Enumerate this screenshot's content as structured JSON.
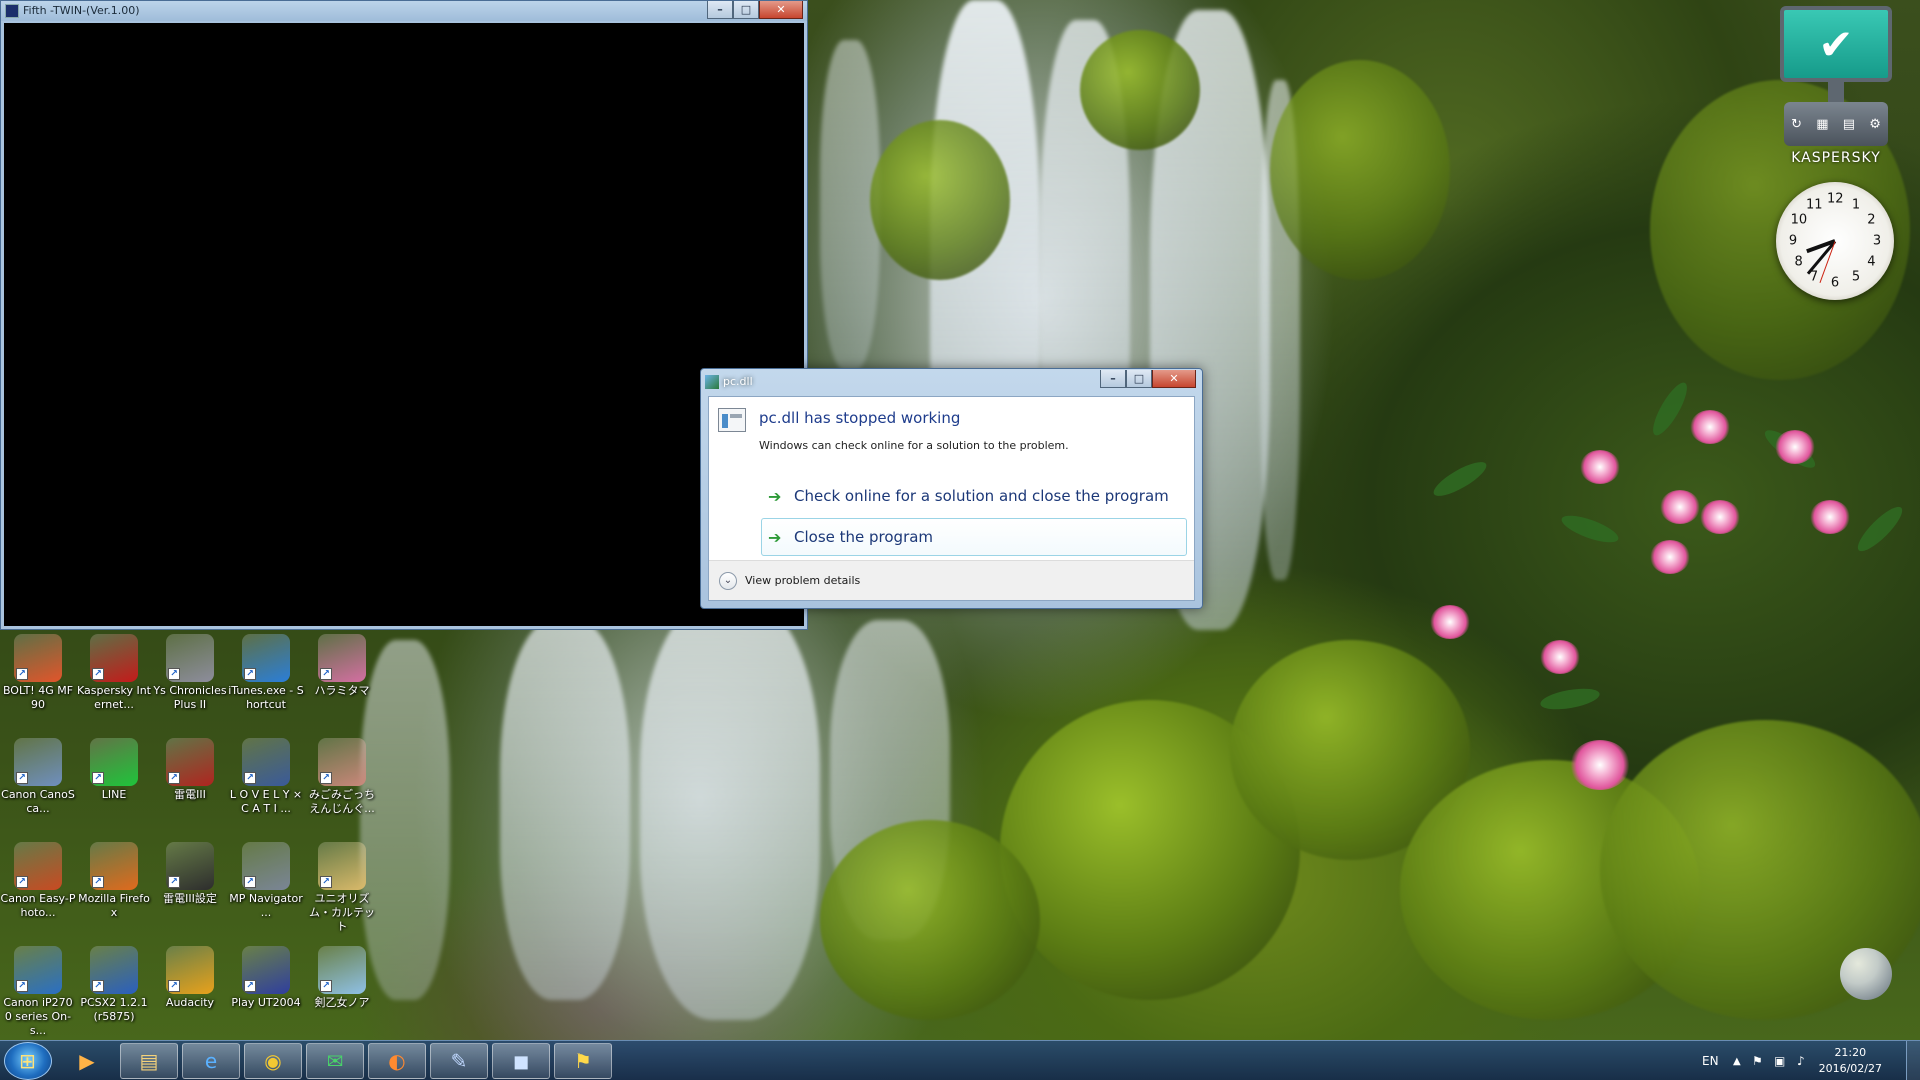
{
  "twin_window": {
    "title": "Fifth -TWIN-(Ver.1.00)"
  },
  "dialog": {
    "title": "pc.dll",
    "heading": "pc.dll has stopped working",
    "description": "Windows can check online for a solution to the problem.",
    "option_check": "Check online for a solution and close the program",
    "option_close": "Close the program",
    "details": "View problem details"
  },
  "desktop_icons": [
    {
      "label": "BOLT! 4G MF90",
      "icon": "bolt-icon",
      "color": "#e2552b"
    },
    {
      "label": "Kaspersky Internet...",
      "icon": "kaspersky-icon",
      "color": "#c41a1a"
    },
    {
      "label": "Ys Chronicles Plus II",
      "icon": "ys-icon",
      "color": "#8d8d9c"
    },
    {
      "label": "iTunes.exe - Shortcut",
      "icon": "itunes-icon",
      "color": "#2b7ed8"
    },
    {
      "label": "ハラミタマ",
      "icon": "anime-icon",
      "color": "#d46fa2"
    },
    {
      "label": "Canon CanoSca...",
      "icon": "canon-icon",
      "color": "#6f8fbf"
    },
    {
      "label": "LINE",
      "icon": "line-icon",
      "color": "#1fc43b"
    },
    {
      "label": "雷電III",
      "icon": "raiden-icon",
      "color": "#b0241f"
    },
    {
      "label": "L O V E L Y × C A T I ...",
      "icon": "lovely-icon",
      "color": "#3a5a9a"
    },
    {
      "label": "みごみごっちえんじんぐ...",
      "icon": "game-icon",
      "color": "#c9877a"
    },
    {
      "label": "Canon Easy-Photo...",
      "icon": "canon-photo-icon",
      "color": "#c94a22"
    },
    {
      "label": "Mozilla Firefox",
      "icon": "firefox-icon",
      "color": "#e06a1d"
    },
    {
      "label": "雷電III設定",
      "icon": "gamepad-icon",
      "color": "#2d2d2d"
    },
    {
      "label": "MP Navigator ...",
      "icon": "mp-navigator-icon",
      "color": "#7a8596"
    },
    {
      "label": "ユニオリズム・カルテット",
      "icon": "unirhythm-icon",
      "color": "#d9b96a"
    },
    {
      "label": "Canon iP2700 series On-s...",
      "icon": "canon-manual-icon",
      "color": "#2a6fc4"
    },
    {
      "label": "PCSX2 1.2.1 (r5875)",
      "icon": "pcsx2-icon",
      "color": "#2a5fbf"
    },
    {
      "label": "Audacity",
      "icon": "audacity-icon",
      "color": "#e8a11c"
    },
    {
      "label": "Play UT2004",
      "icon": "ut2004-icon",
      "color": "#2f3e9e"
    },
    {
      "label": "剣乙女ノア",
      "icon": "noa-icon",
      "color": "#8fc0e6"
    }
  ],
  "gadgets": {
    "kaspersky_brand": "KASPERSKY",
    "clock_numbers": [
      "12",
      "1",
      "2",
      "3",
      "4",
      "5",
      "6",
      "7",
      "8",
      "9",
      "10",
      "11"
    ]
  },
  "taskbar": {
    "apps": [
      {
        "icon": "media-player-icon",
        "glyph": "▶"
      },
      {
        "icon": "explorer-icon",
        "glyph": "▤"
      },
      {
        "icon": "ie-icon",
        "glyph": "e"
      },
      {
        "icon": "chrome-icon",
        "glyph": "◉"
      },
      {
        "icon": "line-icon",
        "glyph": "✉"
      },
      {
        "icon": "firefox-icon",
        "glyph": "◐"
      },
      {
        "icon": "paint-icon",
        "glyph": "✎"
      },
      {
        "icon": "fifth-twin-icon",
        "glyph": "◼"
      },
      {
        "icon": "error-report-icon",
        "glyph": "⚑"
      }
    ],
    "lang": "EN",
    "time": "21:20",
    "date": "2016/02/27"
  }
}
